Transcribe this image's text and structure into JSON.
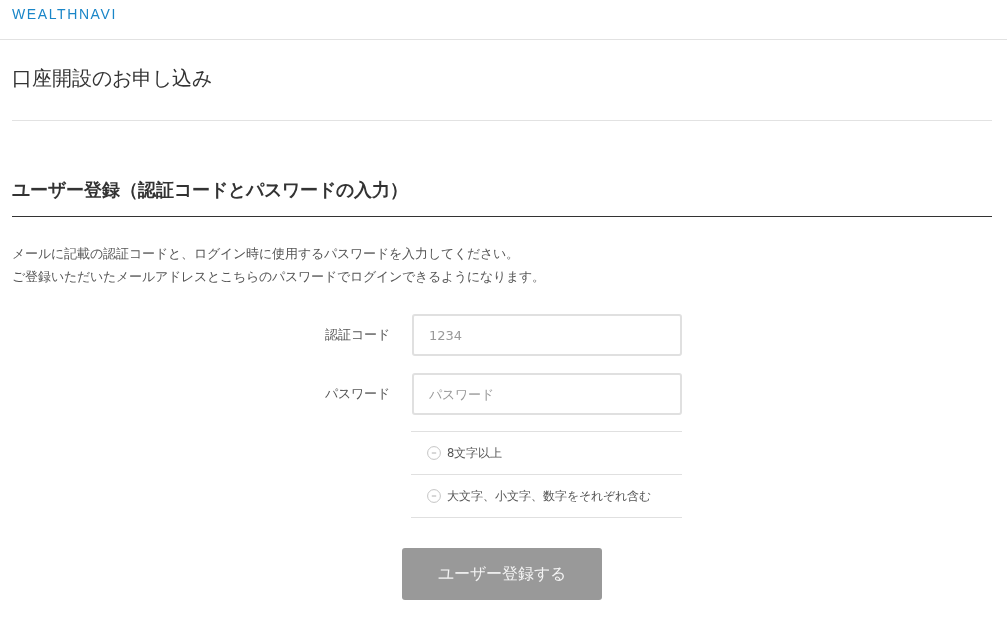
{
  "header": {
    "logo": "WEALTHNAVI"
  },
  "page_title": "口座開設のお申し込み",
  "section": {
    "heading": "ユーザー登録（認証コードとパスワードの入力）",
    "description": [
      "メールに記載の認証コードと、ログイン時に使用するパスワードを入力してください。",
      "ご登録いただいたメールアドレスとこちらのパスワードでログインできるようになります。"
    ]
  },
  "form": {
    "fields": [
      {
        "label": "認証コード",
        "placeholder": "1234"
      },
      {
        "label": "パスワード",
        "placeholder": "パスワード"
      }
    ],
    "requirements": [
      {
        "text": "8文字以上",
        "satisfied": false
      },
      {
        "text": "大文字、小文字、数字をそれぞれ含む",
        "satisfied": false
      }
    ],
    "submit": {
      "label": "ユーザー登録する",
      "disabled": true
    }
  }
}
